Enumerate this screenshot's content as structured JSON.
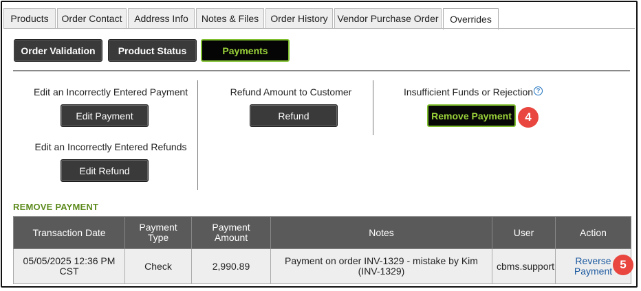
{
  "tabs": [
    "Products",
    "Order Contact",
    "Address Info",
    "Notes & Files",
    "Order History",
    "Vendor Purchase Order",
    "Overrides"
  ],
  "active_tab": "Overrides",
  "subnav": [
    "Order Validation",
    "Product Status",
    "Payments"
  ],
  "active_subnav": "Payments",
  "actions": {
    "edit_payment_label": "Edit an Incorrectly Entered Payment",
    "edit_payment_button": "Edit Payment",
    "edit_refund_label": "Edit an Incorrectly Entered Refunds",
    "edit_refund_button": "Edit Refund",
    "refund_label": "Refund Amount to Customer",
    "refund_button": "Refund",
    "remove_label": "Insufficient Funds or Rejection",
    "help_glyph": "?",
    "remove_button": "Remove Payment"
  },
  "badges": {
    "remove_payment": "4",
    "reverse_payment": "5"
  },
  "colors": {
    "accent_green": "#7fbf2e",
    "badge_red": "#e8463e",
    "link_blue": "#1d5aa0",
    "section_green": "#5c8a1c"
  },
  "section_title": "REMOVE PAYMENT",
  "table": {
    "headers": [
      "Transaction Date",
      "Payment Type",
      "Payment Amount",
      "Notes",
      "User",
      "Action"
    ],
    "rows": [
      {
        "date": "05/05/2025 12:36 PM CST",
        "type": "Check",
        "amount": "2,990.89",
        "notes": "Payment on order INV-1329 - mistake by Kim (INV-1329)",
        "user": "cbms.support",
        "action": "Reverse Payment"
      }
    ]
  }
}
